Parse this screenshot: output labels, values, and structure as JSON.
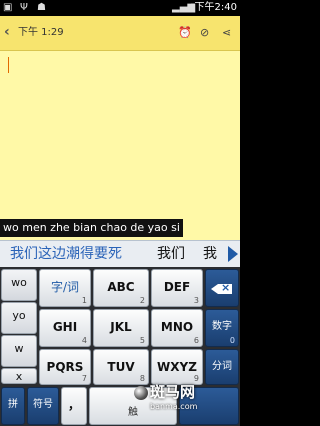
{
  "status_bar": {
    "time": "下午2:40",
    "icons": [
      "notification-icon",
      "usb-icon",
      "android-debug-icon",
      "signal-icon",
      "battery-icon"
    ]
  },
  "note_header": {
    "timestamp": "下午 1:29",
    "icons": [
      "back-icon",
      "alarm-icon",
      "attachment-icon",
      "share-icon"
    ]
  },
  "composition": {
    "text": "wo men zhe bian chao de yao si"
  },
  "candidates": [
    "我们这边潮得要死",
    "我们",
    "我"
  ],
  "keyboard": {
    "side_column": [
      "wo",
      "yo",
      "w",
      "x"
    ],
    "rows": [
      [
        {
          "label": "字/词",
          "num": "1"
        },
        {
          "label": "ABC",
          "num": "2"
        },
        {
          "label": "DEF",
          "num": "3"
        }
      ],
      [
        {
          "label": "GHI",
          "num": "4"
        },
        {
          "label": "JKL",
          "num": "5"
        },
        {
          "label": "MNO",
          "num": "6"
        }
      ],
      [
        {
          "label": "PQRS",
          "num": "7"
        },
        {
          "label": "TUV",
          "num": "8"
        },
        {
          "label": "WXYZ",
          "num": "9"
        }
      ]
    ],
    "right": {
      "digits": "数字",
      "digits_num": "0",
      "split": "分词"
    },
    "bottom": {
      "lang": "拼",
      "symbol": "符号",
      "comma": "，",
      "space": "触"
    }
  },
  "watermark": {
    "brand": "斑马网",
    "url": "banma.com"
  },
  "colors": {
    "note_yellow": "#fff9a7",
    "header_yellow": "#f7e46e",
    "key_blue": "#1f5aa6",
    "candidate_blue": "#2a63b8"
  }
}
